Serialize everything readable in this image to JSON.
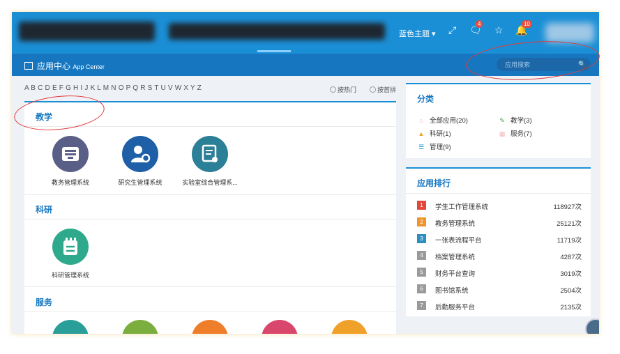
{
  "header": {
    "theme_label": "蓝色主题 ▾",
    "message_badge": "4",
    "notify_badge": "10"
  },
  "subbar": {
    "title": "应用中心",
    "title_en": "App Center",
    "search_placeholder": "应用搜索"
  },
  "alphabet": "A B C D E F G H I J K L M N O P Q R S T U V W X Y Z",
  "sort": {
    "by_hot": "按热门",
    "by_initial": "按首拼"
  },
  "sections": [
    {
      "title": "教学",
      "apps": [
        {
          "name": "教务管理系统",
          "color": "#5a5f87",
          "icon": "inbox-tray-icon"
        },
        {
          "name": "研究生管理系统",
          "color": "#1f5fa8",
          "icon": "user-gear-icon"
        },
        {
          "name": "实验室综合管理系...",
          "color": "#2b7f96",
          "icon": "document-chart-icon"
        }
      ]
    },
    {
      "title": "科研",
      "apps": [
        {
          "name": "科研管理系统",
          "color": "#2ea98c",
          "icon": "notepad-icon"
        }
      ]
    },
    {
      "title": "服务",
      "apps": [
        {
          "name": "",
          "color": "#2a9f9a",
          "icon": "app-icon"
        },
        {
          "name": "",
          "color": "#7cad3f",
          "icon": "app-icon"
        },
        {
          "name": "",
          "color": "#ef7e2b",
          "icon": "app-icon"
        },
        {
          "name": "",
          "color": "#d9476c",
          "icon": "app-icon"
        },
        {
          "name": "",
          "color": "#f0a12a",
          "icon": "app-icon"
        }
      ]
    }
  ],
  "categories": {
    "title": "分类",
    "items": [
      {
        "label": "全部应用(20)",
        "icon": "home-icon",
        "color": "#f1a9a9"
      },
      {
        "label": "教学(3)",
        "icon": "pencil-icon",
        "color": "#43a047"
      },
      {
        "label": "科研(1)",
        "icon": "flask-icon",
        "color": "#f2a12a"
      },
      {
        "label": "服务(7)",
        "icon": "calendar-icon",
        "color": "#f2b8b8"
      },
      {
        "label": "管理(9)",
        "icon": "list-icon",
        "color": "#1b8fd6"
      }
    ]
  },
  "ranking": {
    "title": "应用排行",
    "items": [
      {
        "rank": "1",
        "name": "学生工作管理系统",
        "count": "118927次",
        "color": "#e2463c"
      },
      {
        "rank": "2",
        "name": "教务管理系统",
        "count": "25121次",
        "color": "#f0952b"
      },
      {
        "rank": "3",
        "name": "一张表流程平台",
        "count": "11719次",
        "color": "#2d8fbf"
      },
      {
        "rank": "4",
        "name": "档案管理系统",
        "count": "4287次",
        "color": "#9a9a9a"
      },
      {
        "rank": "5",
        "name": "财务平台查询",
        "count": "3019次",
        "color": "#9a9a9a"
      },
      {
        "rank": "6",
        "name": "图书馆系统",
        "count": "2504次",
        "color": "#9a9a9a"
      },
      {
        "rank": "7",
        "name": "后勤服务平台",
        "count": "2135次",
        "color": "#9a9a9a"
      }
    ]
  },
  "colors": {
    "primary": "#1b8fd6",
    "subbar": "#1677c0",
    "background": "#eef1f5"
  }
}
